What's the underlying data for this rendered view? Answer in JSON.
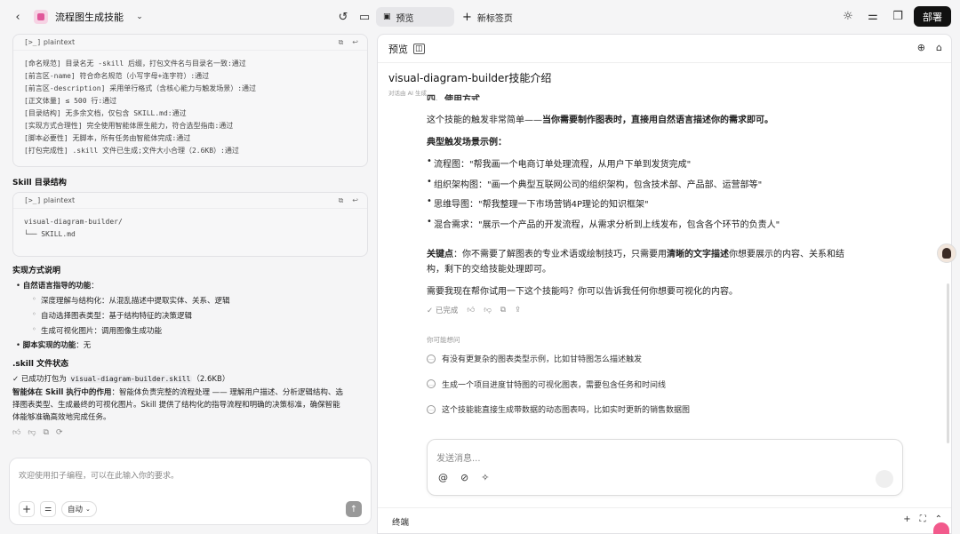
{
  "topbar": {
    "app_title": "流程图生成技能",
    "tab_preview": "预览",
    "tab_new": "新标签页",
    "deploy": "部署"
  },
  "left": {
    "code1": {
      "lang": "plaintext",
      "lines": [
        "[命名规范] 目录名无 -skill 后缀，打包文件名与目录名一致:通过",
        "[前言区-name] 符合命名规范（小写字母+连字符）:通过",
        "[前言区-description] 采用单行格式（含核心能力与触发场景）:通过",
        "[正文体量] ≤ 500 行:通过",
        "[目录结构] 无多余文档，仅包含 SKILL.md:通过",
        "[实现方式合理性] 完全使用智能体原生能力，符合选型指南:通过",
        "[脚本必要性] 无脚本，所有任务由智能体完成:通过",
        "[打包完成性] .skill 文件已生成;文件大小合理（2.6KB）:通过"
      ]
    },
    "skill_dir_title": "Skill 目录结构",
    "code2": {
      "lang": "plaintext",
      "lines": [
        "visual-diagram-builder/",
        "└── SKILL.md"
      ]
    },
    "impl_title": "实现方式说明",
    "bullet1_label": "自然语言指导的功能",
    "bullet1_colon": "：",
    "sub_bullets": [
      "深度理解与结构化：从混乱描述中提取实体、关系、逻辑",
      "自动选择图表类型：基于结构特征的决策逻辑",
      "生成可视化图片：调用图像生成功能"
    ],
    "bullet2_label": "脚本实现的功能",
    "bullet2_value": "：无",
    "status_title": ".skill 文件状态",
    "status_prefix": "✓ 已成功打包为 ",
    "status_file": "visual-diagram-builder.skill",
    "status_size": "（2.6KB）",
    "role_label": "智能体在 Skill 执行中的作用",
    "role_line1": "：智能体负责完整的流程处理 —— 理解用户描述、分析逻辑结构、选",
    "role_line2": "择图表类型、生成最终的可视化图片。Skill 提供了结构化的指导流程和明确的决策标准，确保智能",
    "role_line3": "体能够准确高效地完成任务。",
    "input_placeholder": "欢迎使用扣子编程，可以在此输入你的要求。",
    "mode": "自动"
  },
  "right": {
    "header": "预览",
    "title": "visual-diagram-builder技能介绍",
    "meta": "对话由 AI 生成",
    "cut_heading": "四、使用方式",
    "intro_pre": "这个技能的触发非常简单——",
    "intro_bold": "当你需要制作图表时，直接用自然语言描述你的需求即可。",
    "scenes_title": "典型触发场景示例：",
    "scenes": [
      "流程图：\"帮我画一个电商订单处理流程，从用户下单到发货完成\"",
      "组织架构图：\"画一个典型互联网公司的组织架构，包含技术部、产品部、运营部等\"",
      "思维导图：\"帮我整理一下市场营销4P理论的知识框架\"",
      "混合需求：\"展示一个产品的开发流程，从需求分析到上线发布，包含各个环节的负责人\""
    ],
    "key_label": "关键点",
    "key_text1": "：你不需要了解图表的专业术语或绘制技巧，只需要用",
    "key_bold": "清晰的文字描述",
    "key_text2": "你想要展示的内容、关系和结",
    "key_text3": "构，剩下的交给技能处理即可。",
    "closing": "需要我现在帮你试用一下这个技能吗？你可以告诉我任何你想要可视化的内容。",
    "done": "已完成",
    "suggest_title": "你可能想问",
    "suggestions": [
      "有没有更复杂的图表类型示例，比如甘特图怎么描述触发",
      "生成一个项目进度甘特图的可视化图表，需要包含任务和时间线",
      "这个技能能直接生成带数据的动态图表吗，比如实时更新的销售数据图"
    ],
    "msg_placeholder": "发送消息...",
    "terminal": "终端"
  }
}
